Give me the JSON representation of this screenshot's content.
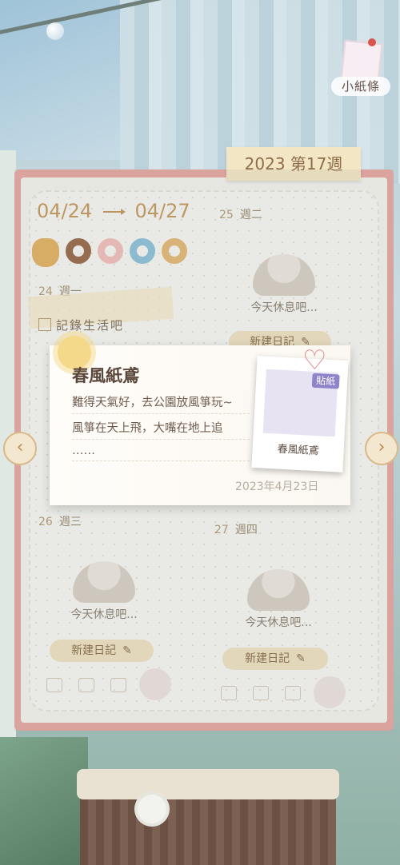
{
  "header": {
    "sticky_label": "小紙條",
    "week_label": "2023 第17週"
  },
  "date_range": {
    "start": "04/24",
    "end": "04/27"
  },
  "moods": [
    "cat-icon",
    "donut-brown-icon",
    "donut-pink-icon",
    "donut-blue-icon",
    "donut-gold-icon"
  ],
  "days": [
    {
      "num": "24",
      "weekday": "週一",
      "task": "記錄生活吧"
    },
    {
      "num": "25",
      "weekday": "週二",
      "rest_text": "今天休息吧...",
      "new_label": "新建日記"
    },
    {
      "num": "26",
      "weekday": "週三",
      "rest_text": "今天休息吧...",
      "new_label": "新建日記"
    },
    {
      "num": "27",
      "weekday": "週四",
      "rest_text": "今天休息吧...",
      "new_label": "新建日記"
    }
  ],
  "popup": {
    "title": "春風紙鳶",
    "lines": [
      "難得天氣好，去公園放風箏玩~",
      "風箏在天上飛，大嘴在地上追",
      "……"
    ],
    "date": "2023年4月23日",
    "sticker_tag": "貼紙",
    "sticker_caption": "春風紙鳶"
  },
  "colors": {
    "book_border": "#e7a7a2",
    "accent": "#c59a5e",
    "page": "#f4f3ee"
  }
}
